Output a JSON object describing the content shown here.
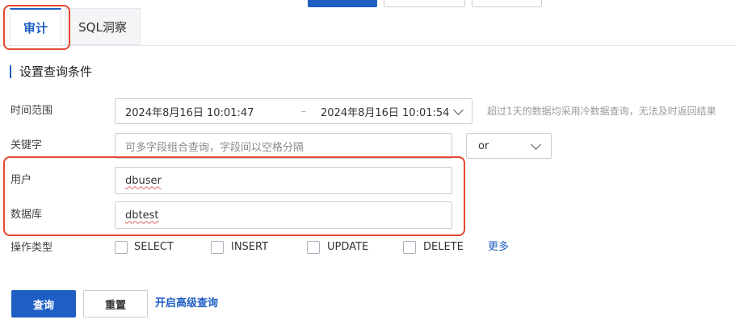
{
  "tabs": [
    {
      "label": "审计",
      "active": true
    },
    {
      "label": "SQL洞察",
      "active": false
    }
  ],
  "section_title": "设置查询条件",
  "form": {
    "time_range": {
      "label": "时间范围",
      "start": "2024年8月16日 10:01:47",
      "separator": "–",
      "end": "2024年8月16日 10:01:54",
      "hint": "超过1天的数据均采用冷数据查询，无法及时返回结果"
    },
    "keyword": {
      "label": "关键字",
      "placeholder": "可多字段组合查询，字段间以空格分隔",
      "operator": "or"
    },
    "user": {
      "label": "用户",
      "value": "dbuser"
    },
    "database": {
      "label": "数据库",
      "value": "dbtest"
    },
    "operation_type": {
      "label": "操作类型",
      "options": [
        {
          "label": "SELECT",
          "checked": false
        },
        {
          "label": "INSERT",
          "checked": false
        },
        {
          "label": "UPDATE",
          "checked": false
        },
        {
          "label": "DELETE",
          "checked": false
        }
      ],
      "more": "更多"
    }
  },
  "actions": {
    "query": "查询",
    "reset": "重置",
    "advanced": "开启高级查询"
  },
  "colors": {
    "accent": "#1f5fc4",
    "highlight_box": "#e3492f"
  }
}
